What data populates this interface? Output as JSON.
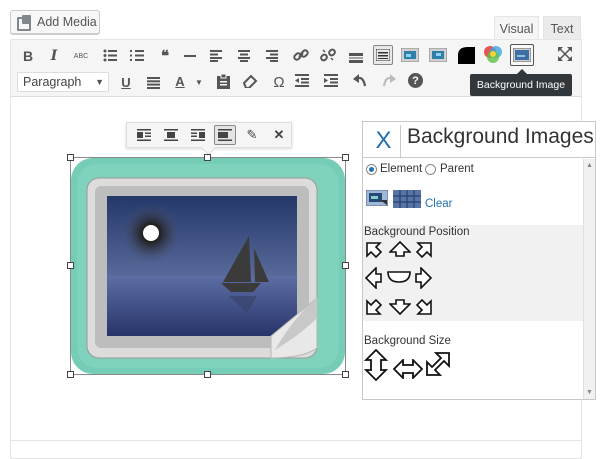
{
  "header": {
    "add_media_label": "Add Media",
    "tabs": [
      {
        "label": "Visual",
        "active": true
      },
      {
        "label": "Text",
        "active": false
      }
    ]
  },
  "toolbar": {
    "row1_icons": [
      "bold-icon",
      "italic-icon",
      "strikethrough-icon",
      "bulleted-list-icon",
      "numbered-list-icon",
      "blockquote-icon",
      "horizontal-line-icon",
      "align-left-icon",
      "align-center-icon",
      "align-right-icon",
      "insert-link-icon",
      "remove-link-icon",
      "read-more-icon",
      "toolbar-toggle-icon",
      "image-insert-icon",
      "image-edit-icon",
      "black-shape-icon",
      "color-wheel-icon",
      "background-image-icon",
      "fullscreen-icon"
    ],
    "bold": "B",
    "italic": "I",
    "strike": "ABC",
    "quote": "66",
    "format_select_value": "Paragraph",
    "underline": "U",
    "text_color": "A",
    "omega": "Ω",
    "help": "?",
    "tooltip": "Background Image"
  },
  "image_toolbar": {
    "icons": [
      "align-left-icon",
      "align-center-icon",
      "align-right-icon",
      "align-none-icon",
      "edit-pencil-icon",
      "remove-x-icon"
    ],
    "active_index": 3,
    "edit": "✎",
    "remove": "✕"
  },
  "bg_panel": {
    "close": "X",
    "title": "Background Images",
    "element_label": "Element",
    "parent_label": "Parent",
    "selected_target": "Element",
    "clear_label": "Clear",
    "position_label": "Background Position",
    "size_label": "Background Size"
  },
  "colors": {
    "accent": "#2271b1",
    "tooltip_bg": "#32373c",
    "image_bg": "#74cdb8"
  }
}
